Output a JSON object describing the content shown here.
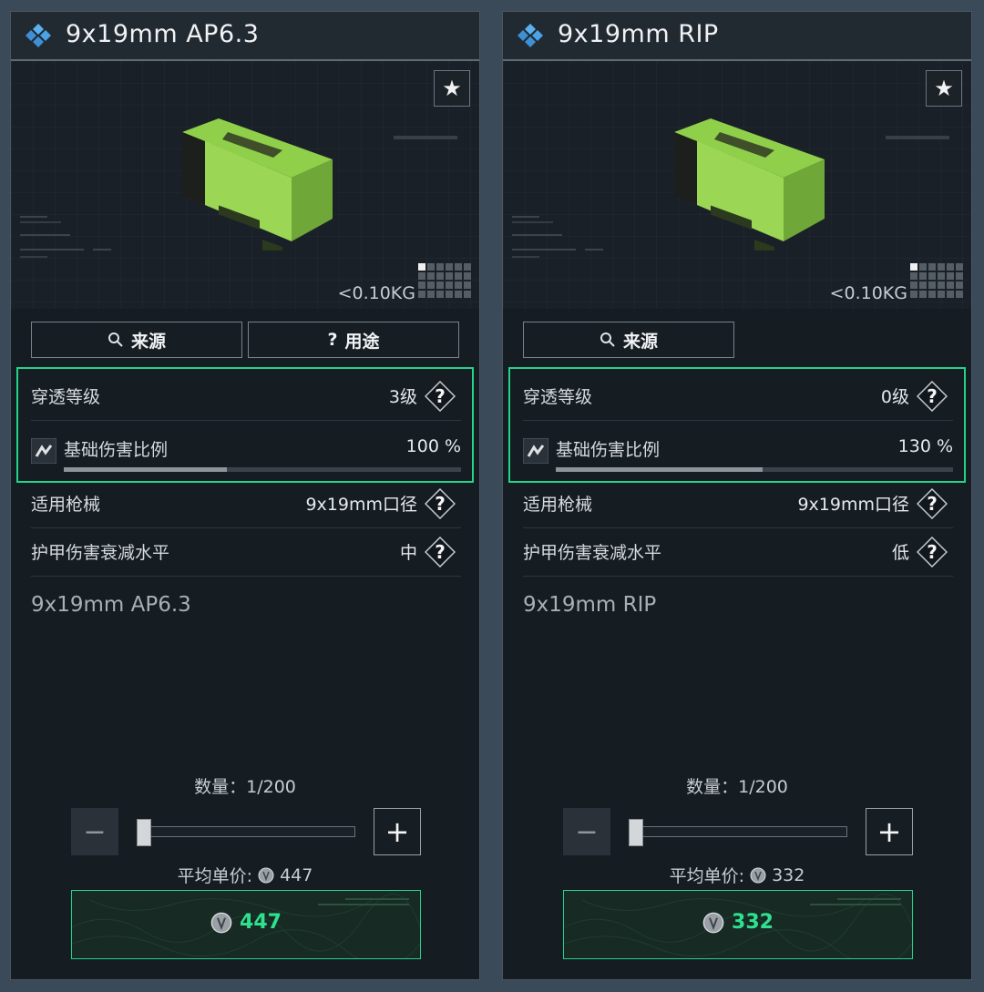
{
  "panels": [
    {
      "title": "9x19mm AP6.3",
      "weight": "<0.10KG",
      "buttons": {
        "source": "来源",
        "usage": "用途"
      },
      "penetration": {
        "label": "穿透等级",
        "value": "3级"
      },
      "base_damage": {
        "label": "基础伤害比例",
        "value": "100 %",
        "fill": 0.41
      },
      "weapon": {
        "label": "适用枪械",
        "value": "9x19mm口径"
      },
      "armor_decay": {
        "label": "护甲伤害衰减水平",
        "value": "中"
      },
      "item_name": "9x19mm AP6.3",
      "quantity": "数量：1/200",
      "avg_price_label": "平均单价:",
      "avg_price": "447",
      "buy_price": "447"
    },
    {
      "title": "9x19mm RIP",
      "weight": "<0.10KG",
      "buttons": {
        "source": "来源"
      },
      "penetration": {
        "label": "穿透等级",
        "value": "0级"
      },
      "base_damage": {
        "label": "基础伤害比例",
        "value": "130 %",
        "fill": 0.52
      },
      "weapon": {
        "label": "适用枪械",
        "value": "9x19mm口径"
      },
      "armor_decay": {
        "label": "护甲伤害衰减水平",
        "value": "低"
      },
      "item_name": "9x19mm RIP",
      "quantity": "数量：1/200",
      "avg_price_label": "平均单价:",
      "avg_price": "332",
      "buy_price": "332"
    }
  ],
  "icons": {
    "favorite": "star-icon",
    "source": "search-icon",
    "usage": "question-icon",
    "help": "question-diamond-icon",
    "damage": "damage-icon",
    "coin": "coin-icon"
  },
  "colors": {
    "highlight": "#23d38a",
    "price": "#2fe08f",
    "title_icon": "#4aa3e8"
  }
}
